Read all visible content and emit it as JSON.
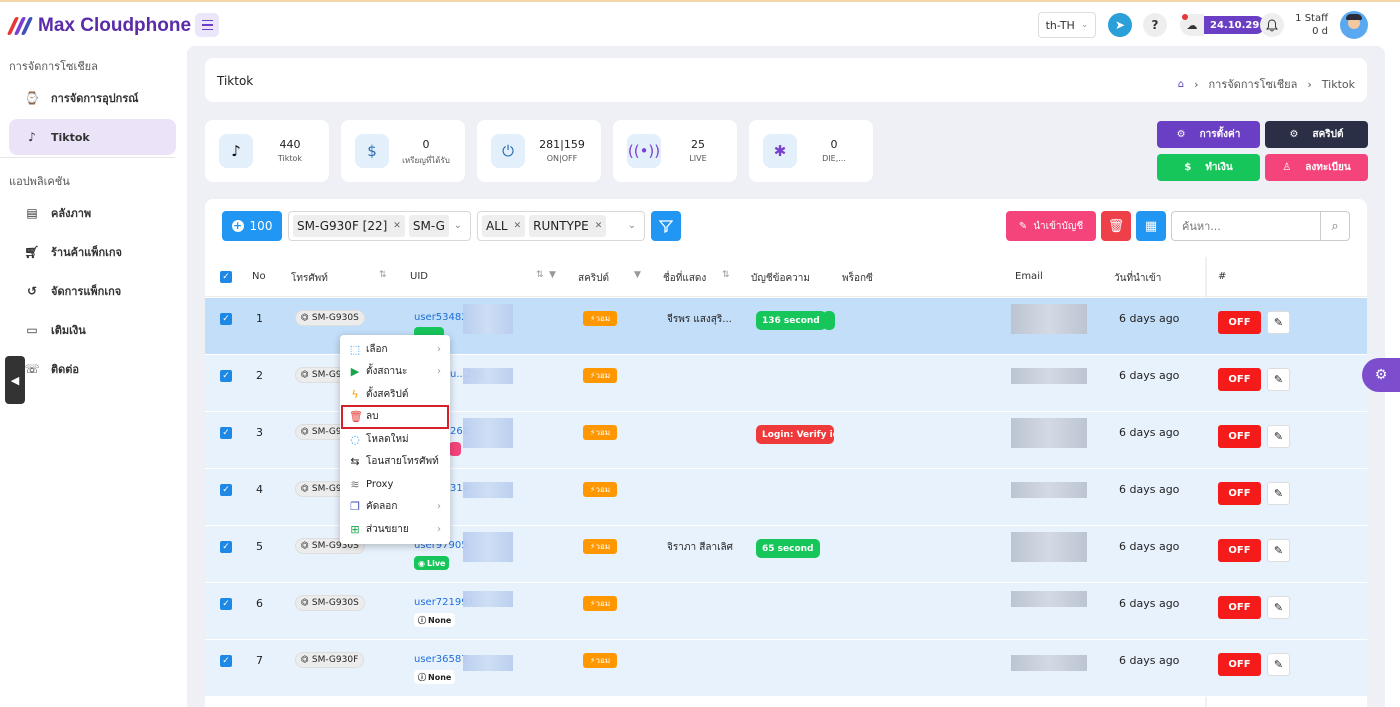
{
  "app": {
    "title": "Max Cloudphone"
  },
  "header": {
    "language": "th-TH",
    "version": "24.10.29",
    "staff": "1 Staff",
    "staff_days": "0 d"
  },
  "sidebar": {
    "section1": "การจัดการโซเชียล",
    "section2": "แอปพลิเคชัน",
    "items": [
      {
        "label": "การจัดการอุปกรณ์",
        "icon": "watch-icon"
      },
      {
        "label": "Tiktok",
        "icon": "tiktok-icon"
      },
      {
        "label": "คลังภาพ",
        "icon": "file-icon"
      },
      {
        "label": "ร้านค้าแพ็กเกจ",
        "icon": "cart-icon"
      },
      {
        "label": "จัดการแพ็กเกจ",
        "icon": "history-icon"
      },
      {
        "label": "เติมเงิน",
        "icon": "wallet-icon"
      },
      {
        "label": "ติดต่อ",
        "icon": "contact-icon"
      }
    ]
  },
  "page": {
    "title": "Tiktok",
    "breadcrumb": [
      "การจัดการโซเชียล",
      "Tiktok"
    ]
  },
  "stats": [
    {
      "value": "440",
      "label": "Tiktok",
      "icon": "tiktok-icon"
    },
    {
      "value": "0",
      "label": "เหรียญที่ได้รับ",
      "icon": "coin-icon"
    },
    {
      "value": "281|159",
      "label": "ON|OFF",
      "icon": "power-icon"
    },
    {
      "value": "25",
      "label": "LIVE",
      "icon": "broadcast-icon"
    },
    {
      "value": "0",
      "label": "DIE,...",
      "icon": "bug-icon"
    }
  ],
  "actions": {
    "settings": "การตั้งค่า",
    "script": "สคริปต์",
    "earn": "ทำเงิน",
    "register": "ลงทะเบียน"
  },
  "toolbar": {
    "count": "100",
    "device_chips": [
      "SM-G930F [22]",
      "SM-G"
    ],
    "type_chips": [
      "ALL",
      "RUNTYPE"
    ],
    "import_label": "นำเข้าบัญชี",
    "search_placeholder": "ค้นหา..."
  },
  "table": {
    "headers": [
      "No",
      "โทรศัพท์",
      "UID",
      "สคริปต์",
      "ชื่อที่แสดง",
      "บัญชีข้อความ",
      "พร็อกซี",
      "Email",
      "วันที่นำเข้า",
      "#"
    ],
    "rows": [
      {
        "no": "1",
        "device": "SM-G930S",
        "uid": "user53482",
        "status": "",
        "script": "วอม",
        "display": "จีรพร แสงสุริ...",
        "msg": "136 second",
        "date": "6 days ago",
        "btn": "OFF"
      },
      {
        "no": "2",
        "device": "SM-G9",
        "uid": "u...200",
        "status": "",
        "script": "วอม",
        "display": "",
        "msg": "",
        "date": "6 days ago",
        "btn": "OFF"
      },
      {
        "no": "3",
        "device": "SM-G9",
        "uid": "268",
        "status": "",
        "script": "วอม",
        "display": "",
        "msg": "Login: Verify iden",
        "date": "6 days ago",
        "btn": "OFF"
      },
      {
        "no": "4",
        "device": "SM-G9",
        "uid": "314",
        "status": "",
        "script": "วอม",
        "display": "",
        "msg": "",
        "date": "6 days ago",
        "btn": "OFF"
      },
      {
        "no": "5",
        "device": "SM-G930S",
        "uid": "user97905",
        "status": "Live",
        "script": "วอม",
        "display": "จิราภา สีลาเลิศ",
        "msg": "65 second",
        "date": "6 days ago",
        "btn": "OFF"
      },
      {
        "no": "6",
        "device": "SM-G930S",
        "uid": "user721997",
        "status": "None",
        "script": "วอม",
        "display": "",
        "msg": "",
        "date": "6 days ago",
        "btn": "OFF"
      },
      {
        "no": "7",
        "device": "SM-G930F",
        "uid": "user36587",
        "status": "None",
        "script": "วอม",
        "display": "",
        "msg": "",
        "date": "6 days ago",
        "btn": "OFF"
      }
    ]
  },
  "context_menu": [
    {
      "label": "เลือก",
      "icon": "select-icon",
      "submenu": true
    },
    {
      "label": "ตั้งสถานะ",
      "icon": "play-circle-icon",
      "submenu": true
    },
    {
      "label": "ตั้งสคริปต์",
      "icon": "lightning-icon",
      "submenu": false
    },
    {
      "label": "ลบ",
      "icon": "trash-icon",
      "submenu": false,
      "highlighted": true
    },
    {
      "label": "โหลดใหม่",
      "icon": "reload-icon",
      "submenu": false
    },
    {
      "label": "โอนสายโทรศัพท์",
      "icon": "transfer-icon",
      "submenu": false
    },
    {
      "label": "Proxy",
      "icon": "wifi-icon",
      "submenu": false
    },
    {
      "label": "คัดลอก",
      "icon": "copy-icon",
      "submenu": true
    },
    {
      "label": "ส่วนขยาย",
      "icon": "extension-icon",
      "submenu": true
    }
  ]
}
